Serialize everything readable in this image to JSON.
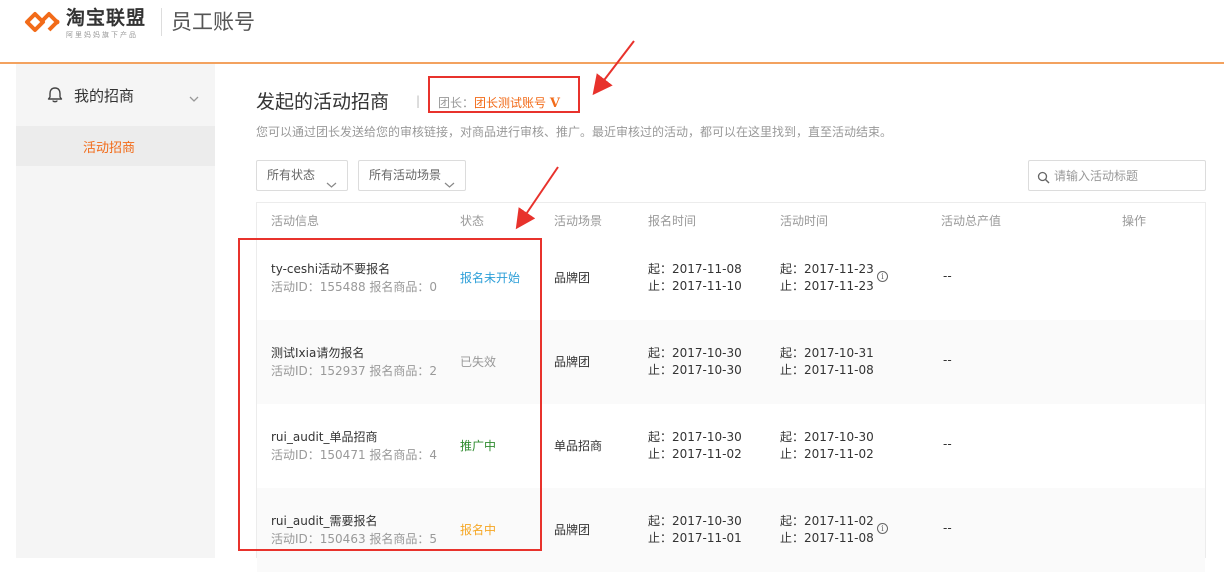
{
  "header": {
    "brand": "淘宝联盟",
    "brand_sub": "阿里妈妈旗下产品",
    "app_title": "员工账号"
  },
  "sidebar": {
    "group_label": "我的招商",
    "items": [
      {
        "label": "活动招商",
        "active": true
      }
    ]
  },
  "main": {
    "title": "发起的活动招商",
    "separator": "|",
    "leader_label": "团长：",
    "leader_name": "团长测试账号",
    "leader_badge": "V",
    "description": "您可以通过团长发送给您的审核链接，对商品进行审核、推广。最近审核过的活动，都可以在这里找到，直至活动结束。",
    "filters": {
      "status": "所有状态",
      "scene": "所有活动场景"
    },
    "search": {
      "placeholder": "请输入活动标题"
    }
  },
  "table": {
    "headers": [
      "活动信息",
      "状态",
      "活动场景",
      "报名时间",
      "活动时间",
      "活动总产值",
      "操作"
    ],
    "rows": [
      {
        "name": "ty-ceshi活动不要报名",
        "meta": "活动ID：155488   报名商品：0",
        "status": "报名未开始",
        "status_color": "#2d9fd8",
        "scene": "品牌团",
        "reg_start": "起：2017-11-08",
        "reg_end": "止：2017-11-10",
        "act_start": "起：2017-11-23",
        "act_end": "止：2017-11-23",
        "value": "--"
      },
      {
        "name": "测试Ixia请勿报名",
        "meta": "活动ID：152937   报名商品：2",
        "status": "已失效",
        "status_color": "#999999",
        "scene": "品牌团",
        "reg_start": "起：2017-10-30",
        "reg_end": "止：2017-10-30",
        "act_start": "起：2017-10-31",
        "act_end": "止：2017-11-08",
        "value": "--"
      },
      {
        "name": "rui_audit_单品招商",
        "meta": "活动ID：150471   报名商品：4",
        "status": "推广中",
        "status_color": "#2e8b2e",
        "scene": "单品招商",
        "reg_start": "起：2017-10-30",
        "reg_end": "止：2017-11-02",
        "act_start": "起：2017-10-30",
        "act_end": "止：2017-11-02",
        "value": "--"
      },
      {
        "name": "rui_audit_需要报名",
        "meta": "活动ID：150463   报名商品：5",
        "status": "报名中",
        "status_color": "#f5a623",
        "scene": "品牌团",
        "reg_start": "起：2017-10-30",
        "reg_end": "止：2017-11-01",
        "act_start": "起：2017-11-02",
        "act_end": "止：2017-11-08",
        "value": "--"
      }
    ]
  },
  "colors": {
    "accent": "#f26b19",
    "annotation": "#e8322c",
    "header_line": "#f3a25f"
  },
  "icons": {
    "brand": "taobao-union-logo",
    "sidebar": "bell-icon",
    "search": "search-icon",
    "info": "info-icon"
  }
}
